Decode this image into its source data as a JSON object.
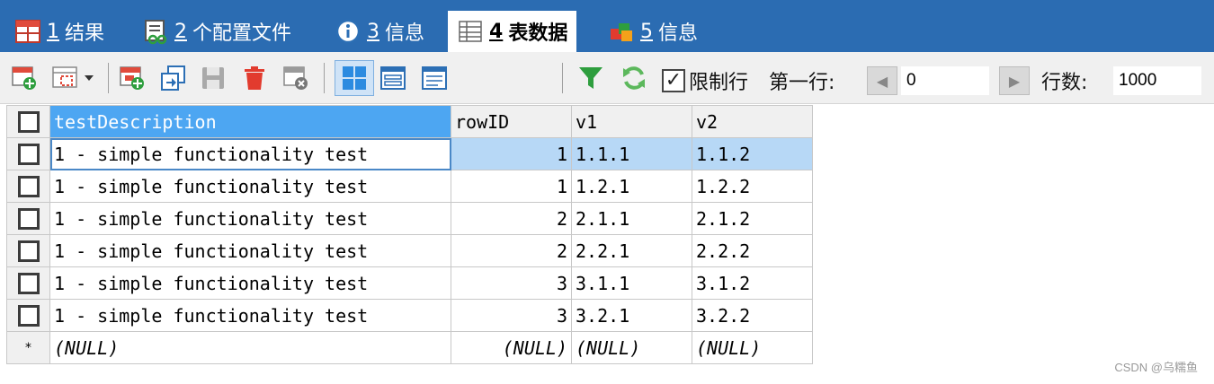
{
  "tabs": [
    {
      "num": "1",
      "label": "结果",
      "active": false
    },
    {
      "num": "2",
      "label": "个配置文件",
      "active": false
    },
    {
      "num": "3",
      "label": "信息",
      "active": false
    },
    {
      "num": "4",
      "label": "表数据",
      "active": true
    },
    {
      "num": "5",
      "label": "信息",
      "active": false
    }
  ],
  "toolbar": {
    "limit_rows_checked": true,
    "limit_rows_label": "限制行",
    "first_row_label": "第一行:",
    "first_row_value": "0",
    "row_count_label": "行数:",
    "row_count_value": "1000",
    "icons": [
      "insert-row-icon",
      "column-chooser-icon",
      "duplicate-row-icon",
      "refresh-grid-icon",
      "save-icon",
      "delete-icon",
      "cancel-changes-icon",
      "grid-view-icon",
      "form-view-icon",
      "text-view-icon",
      "filter-icon",
      "refresh-icon"
    ]
  },
  "grid": {
    "columns": [
      "testDescription",
      "rowID",
      "v1",
      "v2"
    ],
    "rows": [
      [
        "1 - simple functionality test",
        "1",
        "1.1.1",
        "1.1.2"
      ],
      [
        "1 - simple functionality test",
        "1",
        "1.2.1",
        "1.2.2"
      ],
      [
        "1 - simple functionality test",
        "2",
        "2.1.1",
        "2.1.2"
      ],
      [
        "1 - simple functionality test",
        "2",
        "2.2.1",
        "2.2.2"
      ],
      [
        "1 - simple functionality test",
        "3",
        "3.1.1",
        "3.1.2"
      ],
      [
        "1 - simple functionality test",
        "3",
        "3.2.1",
        "3.2.2"
      ]
    ],
    "new_row_marker": "*",
    "null_text": "(NULL)",
    "selected_row": 0
  },
  "watermark": "CSDN @乌糯鱼",
  "colors": {
    "tabbar": "#2b6cb2",
    "header_highlight": "#4da6f2",
    "selected_row": "#b7d8f6"
  }
}
